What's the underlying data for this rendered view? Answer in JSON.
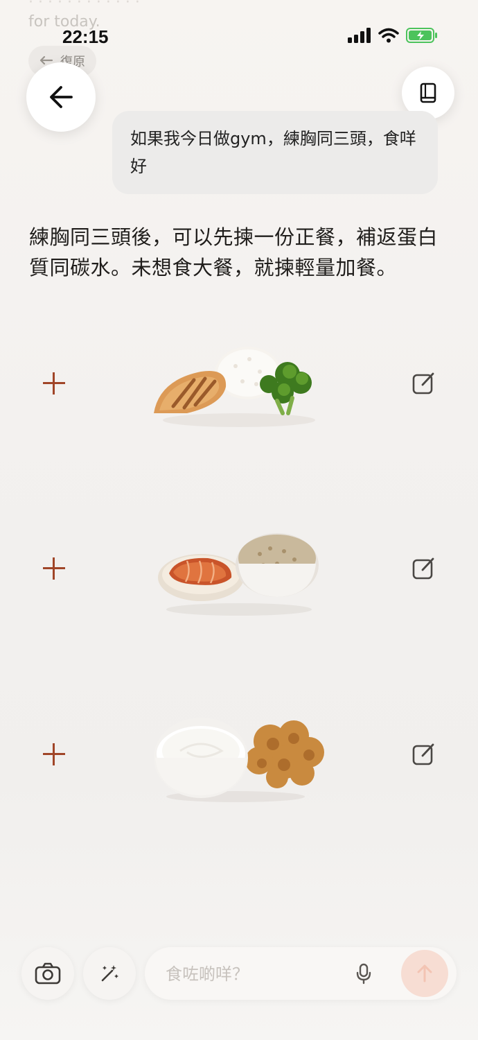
{
  "status_bar": {
    "time": "22:15"
  },
  "behind_content": {
    "line1": "for today.",
    "undo_label": "復原"
  },
  "chat": {
    "user_message": "如果我今日做gym，練胸同三頭，食咩好",
    "assistant_reply": "練胸同三頭後，可以先揀一份正餐，補返蛋白質同碳水。未想食大餐，就揀輕量加餐。"
  },
  "meal_options": [
    {
      "name": "chicken-rice-broccoli",
      "icons": [
        "plus-icon",
        "edit-icon"
      ]
    },
    {
      "name": "salmon-brown-rice",
      "icons": [
        "plus-icon",
        "edit-icon"
      ]
    },
    {
      "name": "yogurt-walnuts",
      "icons": [
        "plus-icon",
        "edit-icon"
      ]
    }
  ],
  "composer": {
    "placeholder": "食咗啲咩？"
  },
  "colors": {
    "accent": "#a04528",
    "send_button": "#f7ddd3",
    "bubble": "#ecebea"
  }
}
